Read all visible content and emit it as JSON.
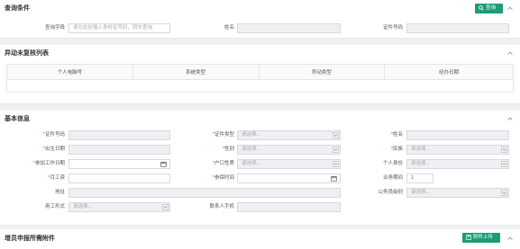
{
  "query": {
    "title": "查询条件",
    "search_button": "查询",
    "field_label": "查询字段",
    "field_placeholder": "请在此处输入身份证号码，回车查询",
    "name_label": "姓名",
    "id_label": "证件号码"
  },
  "pending": {
    "title": "异动未复核列表",
    "columns": [
      "个人电脑号",
      "系统类型",
      "异动类型",
      "经办日期"
    ]
  },
  "basic": {
    "title": "基本信息",
    "select_placeholder": "请选择...",
    "labels": {
      "id_number": "证件号码",
      "id_type": "证件类型",
      "name": "姓名",
      "birth_date": "出生日期",
      "gender": "性别",
      "ethnicity": "民族",
      "work_start_date": "参加工作日期",
      "household": "户口性质",
      "identity": "个人身份",
      "wage": "月工资",
      "insured_time": "参保时间",
      "business_period": "业务期间",
      "address": "地址",
      "civil_level": "公务员级别",
      "employment_form": "用工形式",
      "contact_phone": "联系人手机"
    },
    "business_period_value": "1"
  },
  "attachments": {
    "title": "增员申报所需附件",
    "upload_button": "附件上传"
  },
  "colors": {
    "accent_green": "#1e9b74",
    "required_red": "#e84b3c",
    "readonly_bg": "#eef0f3"
  }
}
